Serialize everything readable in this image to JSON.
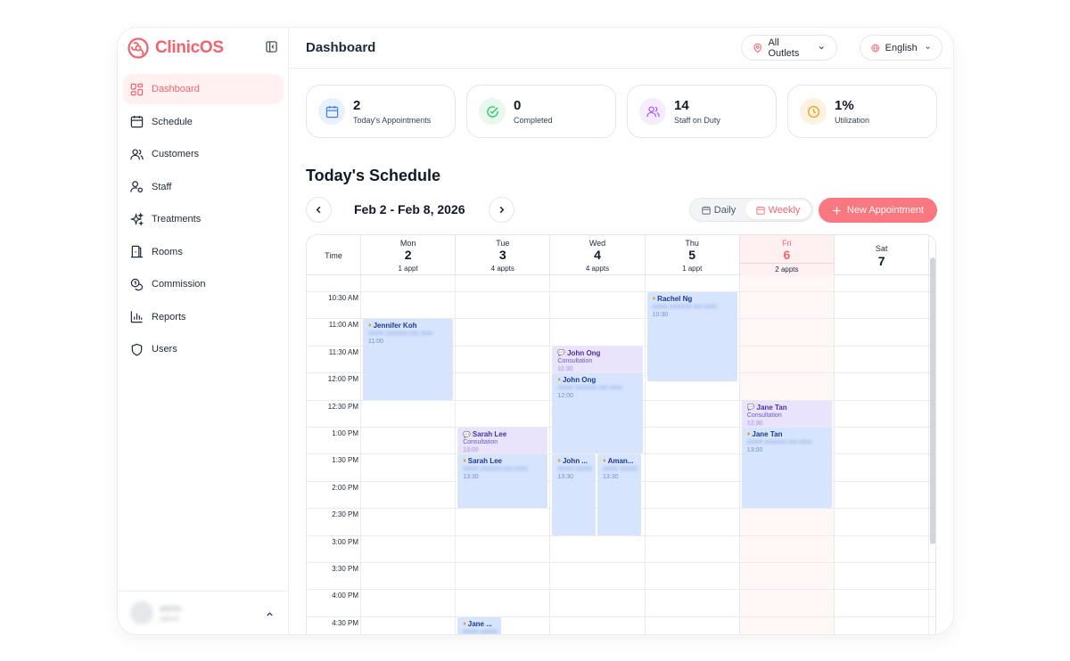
{
  "brand": {
    "name": "ClinicOS"
  },
  "sidebar": {
    "items": [
      {
        "label": "Dashboard",
        "icon": "dashboard-icon",
        "active": true
      },
      {
        "label": "Schedule",
        "icon": "calendar-icon"
      },
      {
        "label": "Customers",
        "icon": "users-icon"
      },
      {
        "label": "Staff",
        "icon": "staff-icon"
      },
      {
        "label": "Treatments",
        "icon": "sparkles-icon"
      },
      {
        "label": "Rooms",
        "icon": "door-icon"
      },
      {
        "label": "Commission",
        "icon": "coins-icon"
      },
      {
        "label": "Reports",
        "icon": "bar-chart-icon"
      },
      {
        "label": "Users",
        "icon": "shield-icon"
      }
    ],
    "user": {
      "name": "admin",
      "role": "admin"
    }
  },
  "header": {
    "title": "Dashboard",
    "outlet": "All Outlets",
    "language": "English"
  },
  "stats": [
    {
      "value": "2",
      "label": "Today's Appointments",
      "icon": "calendar-icon",
      "color": "#3b82f6"
    },
    {
      "value": "0",
      "label": "Completed",
      "icon": "check-circle-icon",
      "color": "#22c55e"
    },
    {
      "value": "14",
      "label": "Staff on Duty",
      "icon": "users-icon",
      "color": "#a855f7"
    },
    {
      "value": "1%",
      "label": "Utilization",
      "icon": "clock-icon",
      "color": "#f59e0b"
    }
  ],
  "schedule": {
    "title": "Today's Schedule",
    "date_range": "Feb 2 - Feb 8, 2026",
    "view_daily": "Daily",
    "view_weekly": "Weekly",
    "active_view": "Weekly",
    "new_appointment": "New Appointment",
    "time_header": "Time",
    "days": [
      {
        "name": "Mon",
        "num": "2",
        "count": "1 appt"
      },
      {
        "name": "Tue",
        "num": "3",
        "count": "4 appts"
      },
      {
        "name": "Wed",
        "num": "4",
        "count": "4 appts"
      },
      {
        "name": "Thu",
        "num": "5",
        "count": "1 appt"
      },
      {
        "name": "Fri",
        "num": "6",
        "count": "2 appts",
        "today": true
      },
      {
        "name": "Sat",
        "num": "7",
        "count": ""
      }
    ],
    "times": [
      "10:30 AM",
      "11:00 AM",
      "11:30 AM",
      "12:00 PM",
      "12:30 PM",
      "1:00 PM",
      "1:30 PM",
      "2:00 PM",
      "2:30 PM",
      "3:00 PM",
      "3:30 PM",
      "4:00 PM",
      "4:30 PM"
    ],
    "appointments": [
      {
        "day": 0,
        "start": "11:00",
        "end": "12:30",
        "lane": 0,
        "lanes": 1,
        "name": "Jennifer Koh",
        "kind": "treatment",
        "time": "11:00"
      },
      {
        "day": 1,
        "start": "13:00",
        "end": "13:30",
        "lane": 0,
        "lanes": 1,
        "name": "Sarah Lee",
        "kind": "consultation",
        "sub": "Consultation",
        "time": "13:00"
      },
      {
        "day": 1,
        "start": "13:30",
        "end": "14:30",
        "lane": 0,
        "lanes": 1,
        "name": "Sarah Lee",
        "kind": "treatment",
        "time": "13:30"
      },
      {
        "day": 1,
        "start": "16:30",
        "end": "17:00",
        "lane": 0,
        "lanes": 2,
        "name": "Jane ...",
        "kind": "treatment",
        "time": ""
      },
      {
        "day": 2,
        "start": "11:30",
        "end": "12:00",
        "lane": 0,
        "lanes": 1,
        "name": "John Ong",
        "kind": "consultation",
        "sub": "Consultation",
        "time": "11:30"
      },
      {
        "day": 2,
        "start": "12:00",
        "end": "13:30",
        "lane": 0,
        "lanes": 1,
        "name": "John Ong",
        "kind": "treatment",
        "time": "12:00"
      },
      {
        "day": 2,
        "start": "13:30",
        "end": "15:00",
        "lane": 0,
        "lanes": 2,
        "name": "John ...",
        "kind": "treatment",
        "time": "13:30"
      },
      {
        "day": 2,
        "start": "13:30",
        "end": "15:00",
        "lane": 1,
        "lanes": 2,
        "name": "Aman...",
        "kind": "treatment",
        "time": "13:30"
      },
      {
        "day": 3,
        "start": "10:30",
        "end": "12:10",
        "lane": 0,
        "lanes": 1,
        "name": "Rachel Ng",
        "kind": "treatment",
        "time": "10:30"
      },
      {
        "day": 4,
        "start": "12:30",
        "end": "13:00",
        "lane": 0,
        "lanes": 1,
        "name": "Jane Tan",
        "kind": "consultation",
        "sub": "Consultation",
        "time": "12:30"
      },
      {
        "day": 4,
        "start": "13:00",
        "end": "14:30",
        "lane": 0,
        "lanes": 1,
        "name": "Jane Tan",
        "kind": "treatment",
        "time": "13:00"
      }
    ]
  },
  "colors": {
    "accent": "#f0646d",
    "accent_button": "#f9777e",
    "treatment_block": "#d6e4fd",
    "consultation_block": "#e9e3fb",
    "today_column": "#fff6f6"
  }
}
